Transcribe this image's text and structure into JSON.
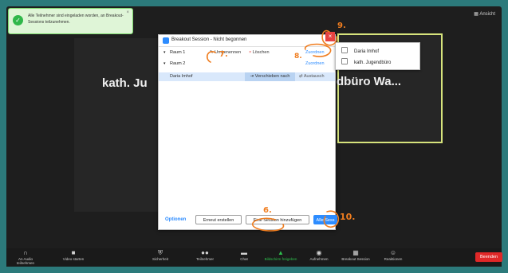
{
  "notification": {
    "message": "Alle Teilnehmer sind eingeladen worden, an Breakout-Sessions teilzunehmen.",
    "icon": "check-icon",
    "close": "×"
  },
  "view_button": "Ansicht",
  "stage": {
    "name_left": "kath. Ju",
    "name_right": "dbüro Wa..."
  },
  "dialog": {
    "title": "Breakout Session - Nicht begonnen",
    "close": "×",
    "rooms": [
      {
        "label": "Raum 1",
        "caret": "▾"
      },
      {
        "label": "Raum 2",
        "caret": "▾"
      }
    ],
    "rename": "Umbenennen",
    "delete": "Löschen",
    "delete_icon": "×",
    "assign_1": "Zuordnen",
    "assign_2": "Zuordnen",
    "member_name": "Daria Imhof",
    "move_to": "Verschieben nach",
    "exchange": "Austausch",
    "options": "Optionen",
    "recreate": "Erneut erstellen",
    "add_session": "Eine Session hinzufügen",
    "start_all": "Alle Sess"
  },
  "assign_popup": {
    "participants": [
      "Daria Imhof",
      "kath. Jugendbüro"
    ]
  },
  "annotations": [
    "9.",
    "7.",
    "8.",
    "6.",
    "10."
  ],
  "toolbar": {
    "items": [
      {
        "label": "An Audio teilnehmen",
        "icon": "headphones-icon"
      },
      {
        "label": "Video starten",
        "icon": "video-off-icon"
      },
      {
        "label": "Sicherheit",
        "icon": "shield-icon"
      },
      {
        "label": "Teilnehmer",
        "icon": "participants-icon",
        "count": "3"
      },
      {
        "label": "Chat",
        "icon": "chat-icon"
      },
      {
        "label": "Bildschirm freigeben",
        "icon": "share-screen-icon"
      },
      {
        "label": "Aufnehmen",
        "icon": "record-icon"
      },
      {
        "label": "Breakout Session",
        "icon": "breakout-icon"
      },
      {
        "label": "Reaktionen",
        "icon": "reaction-icon"
      }
    ],
    "end": "Beenden"
  },
  "colors": {
    "accent_blue": "#2d8cff",
    "close_red": "#e64240",
    "annotation_orange": "#f07d1f",
    "share_green": "#2ec04d",
    "end_red": "#e02828",
    "speaker_border": "#d6e37c"
  }
}
